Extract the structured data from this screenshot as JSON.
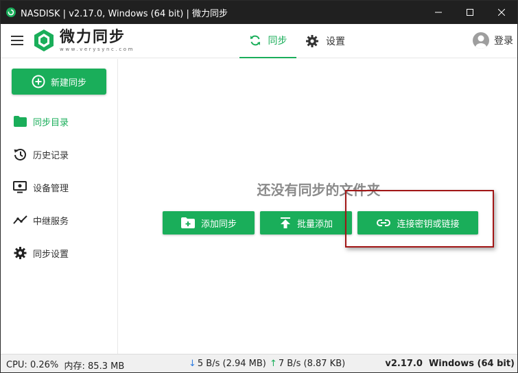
{
  "window": {
    "title": "NASDISK | v2.17.0, Windows (64 bit) | 微力同步"
  },
  "header": {
    "brand_name": "微力同步",
    "brand_url": "www.verysync.com",
    "tabs": [
      {
        "label": "同步",
        "icon": "sync-icon",
        "active": true
      },
      {
        "label": "设置",
        "icon": "gear-icon",
        "active": false
      }
    ],
    "login_label": "登录"
  },
  "sidebar": {
    "new_sync_label": "新建同步",
    "items": [
      {
        "label": "同步目录",
        "icon": "folder-icon",
        "active": true
      },
      {
        "label": "历史记录",
        "icon": "history-icon",
        "active": false
      },
      {
        "label": "设备管理",
        "icon": "device-icon",
        "active": false
      },
      {
        "label": "中继服务",
        "icon": "relay-icon",
        "active": false
      },
      {
        "label": "同步设置",
        "icon": "gear-icon",
        "active": false
      }
    ]
  },
  "main": {
    "empty_message": "还没有同步的文件夹",
    "buttons": {
      "add": "添加同步",
      "batch": "批量添加",
      "link": "连接密钥或链接"
    }
  },
  "status": {
    "cpu": "CPU: 0.26%",
    "memory": "内存: 85.3 MB",
    "download": "5 B/s (2.94 MB)",
    "upload": "7 B/s (8.87 KB)",
    "version": "v2.17.0",
    "platform": "Windows (64 bit)"
  },
  "colors": {
    "accent": "#1aae5a",
    "titlebar": "#202020",
    "highlight": "#a11515"
  }
}
